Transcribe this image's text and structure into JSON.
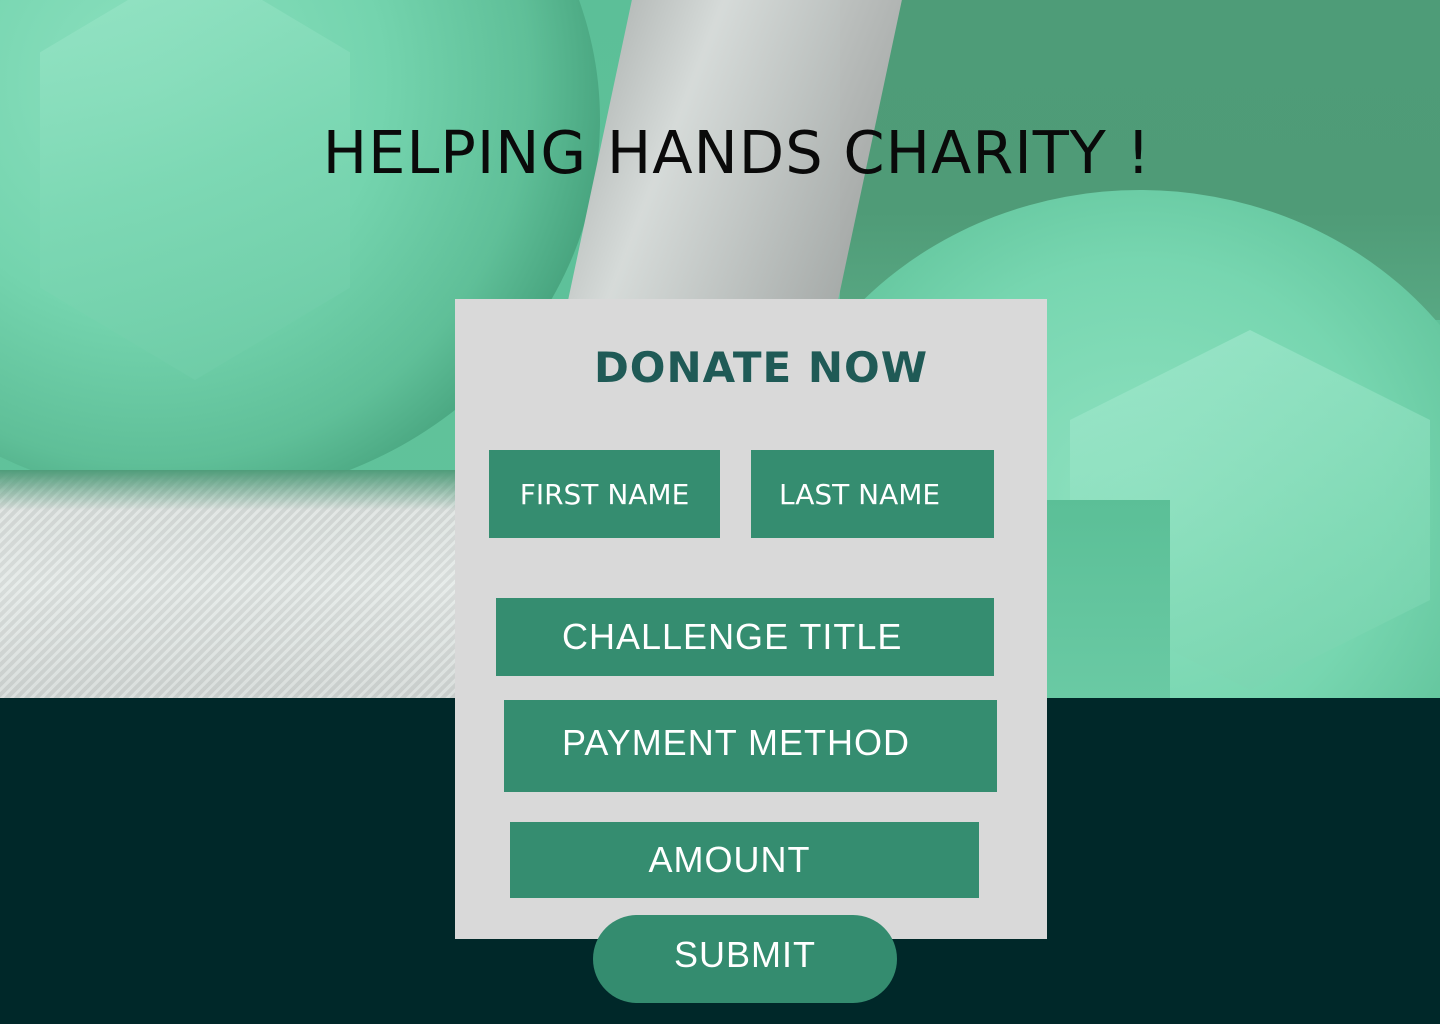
{
  "header": {
    "title": "HELPING HANDS CHARITY !"
  },
  "form": {
    "heading": "DONATE NOW",
    "fields": {
      "first_name": "FIRST NAME",
      "last_name": "LAST NAME",
      "challenge_title": "CHALLENGE TITLE",
      "payment_method": "PAYMENT METHOD",
      "amount": "AMOUNT"
    },
    "submit_label": "SUBMIT"
  },
  "colors": {
    "field_background": "#358d70",
    "card_background": "#d9d9d9",
    "heading_text": "#1f5a56",
    "footer_background": "#002829"
  }
}
